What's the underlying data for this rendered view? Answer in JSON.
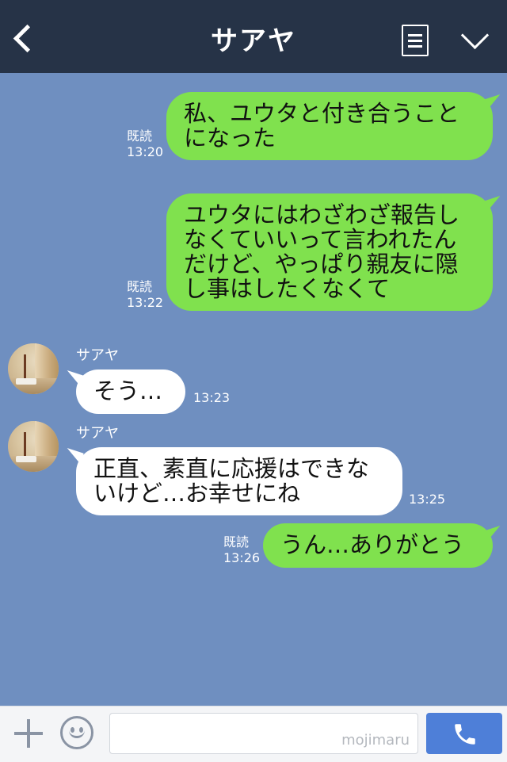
{
  "header": {
    "title": "サアヤ",
    "back_icon": "chevron-left-icon",
    "menu_icon": "menu-icon",
    "collapse_icon": "chevron-down-icon"
  },
  "messages": [
    {
      "direction": "sent",
      "lines": [
        "私、ユウタと付き合うこと",
        "になった"
      ],
      "read": "既読",
      "time": "13:20"
    },
    {
      "direction": "sent",
      "lines": [
        "ユウタにはわざわざ報告し",
        "なくていいって言われたん",
        "だけど、やっぱり親友に隠",
        "し事はしたくなくて"
      ],
      "read": "既読",
      "time": "13:22"
    },
    {
      "direction": "received",
      "sender": "サアヤ",
      "lines": [
        "そう…"
      ],
      "time": "13:23"
    },
    {
      "direction": "received",
      "sender": "サアヤ",
      "lines": [
        "正直、素直に応援はできな",
        "いけど…お幸せにね"
      ],
      "time": "13:25"
    },
    {
      "direction": "sent",
      "lines": [
        "うん…ありがとう"
      ],
      "read": "既読",
      "time": "13:26"
    }
  ],
  "input_bar": {
    "plus_icon": "plus-icon",
    "emoji_icon": "emoji-icon",
    "input_value": "",
    "watermark": "mojimaru",
    "call_icon": "phone-icon"
  },
  "colors": {
    "background": "#6f8fc0",
    "header": "#263347",
    "sent_bubble": "#80e14e",
    "received_bubble": "#ffffff",
    "call_button": "#4e7fd8"
  }
}
